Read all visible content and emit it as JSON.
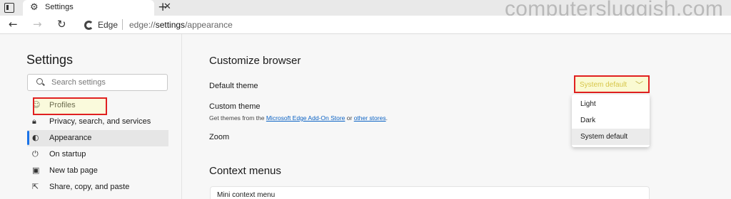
{
  "watermark": "computersluggish.com",
  "tabs": [
    {
      "title": "Settings",
      "favicon": "gear-icon"
    }
  ],
  "address_bar": {
    "origin": "Edge",
    "url_prefix": "edge://",
    "url_bold": "settings",
    "url_suffix": "/appearance"
  },
  "sidebar": {
    "title": "Settings",
    "search_placeholder": "Search settings",
    "items": [
      {
        "label": "Profiles",
        "icon": "profile-icon",
        "active": false
      },
      {
        "label": "Privacy, search, and services",
        "icon": "lock-icon",
        "active": false
      },
      {
        "label": "Appearance",
        "icon": "palette-icon",
        "active": true
      },
      {
        "label": "On startup",
        "icon": "power-icon",
        "active": false
      },
      {
        "label": "New tab page",
        "icon": "new-tab-icon",
        "active": false
      },
      {
        "label": "Share, copy, and paste",
        "icon": "share-icon",
        "active": false
      }
    ]
  },
  "main": {
    "customize_heading": "Customize browser",
    "default_theme_label": "Default theme",
    "default_theme_value": "System default",
    "custom_theme_label": "Custom theme",
    "custom_theme_desc_pre": "Get themes from the ",
    "custom_theme_link1": "Microsoft Edge Add-On Store",
    "custom_theme_desc_mid": " or ",
    "custom_theme_link2": "other stores",
    "custom_theme_desc_post": ".",
    "zoom_label": "Zoom",
    "context_heading": "Context menus",
    "mini_context_label": "Mini context menu",
    "theme_options": [
      "Light",
      "Dark",
      "System default"
    ],
    "theme_selected": "System default"
  },
  "colors": {
    "highlight_border": "#e02020",
    "link": "#0b62c4",
    "active_indicator": "#1a73e8"
  }
}
